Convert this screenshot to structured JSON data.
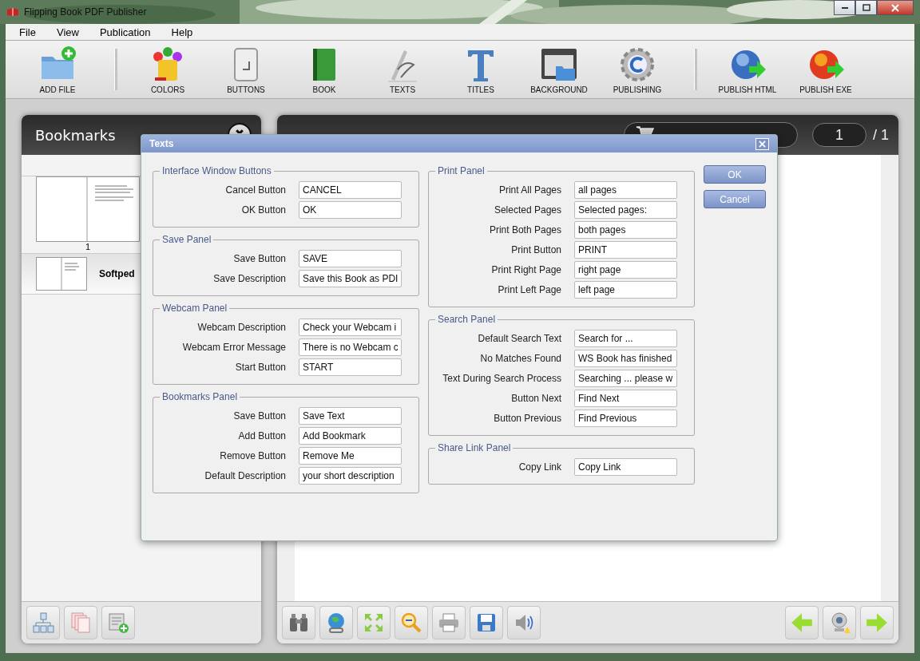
{
  "window": {
    "title": "Flipping Book PDF Publisher"
  },
  "menu": [
    "File",
    "View",
    "Publication",
    "Help"
  ],
  "toolbar_groups": [
    [
      {
        "label": "ADD FILE"
      }
    ],
    [
      {
        "label": "COLORS"
      },
      {
        "label": "BUTTONS"
      },
      {
        "label": "BOOK"
      },
      {
        "label": "TEXTS"
      },
      {
        "label": "TITLES"
      },
      {
        "label": "BACKGROUND"
      },
      {
        "label": "PUBLISHING"
      }
    ],
    [
      {
        "label": "PUBLISH HTML"
      },
      {
        "label": "PUBLISH EXE"
      }
    ]
  ],
  "bookmarks": {
    "title": "Bookmarks",
    "pages": [
      {
        "caption": "1"
      }
    ],
    "items": [
      {
        "label": "Softped",
        "selected": true
      }
    ]
  },
  "document": {
    "page_field": "1",
    "page_total": "/ 1"
  },
  "dialog": {
    "title": "Texts",
    "left_panels": [
      {
        "title": "Interface Window Buttons",
        "fields": [
          {
            "label": "Cancel Button",
            "value": "CANCEL"
          },
          {
            "label": "OK Button",
            "value": "OK"
          }
        ]
      },
      {
        "title": "Save Panel",
        "fields": [
          {
            "label": "Save Button",
            "value": "SAVE"
          },
          {
            "label": "Save Description",
            "value": "Save this Book as PDI"
          }
        ]
      },
      {
        "title": "Webcam Panel",
        "fields": [
          {
            "label": "Webcam Description",
            "value": "Check your Webcam i"
          },
          {
            "label": "Webcam Error Message",
            "value": "There is no Webcam c"
          },
          {
            "label": "Start Button",
            "value": "START"
          }
        ]
      },
      {
        "title": "Bookmarks Panel",
        "fields": [
          {
            "label": "Save Button",
            "value": "Save Text"
          },
          {
            "label": "Add Button",
            "value": "Add Bookmark"
          },
          {
            "label": "Remove Button",
            "value": "Remove Me"
          },
          {
            "label": "Default Description",
            "value": "your short description"
          }
        ]
      }
    ],
    "right_panels": [
      {
        "title": "Print Panel",
        "fields": [
          {
            "label": "Print All Pages",
            "value": "all pages"
          },
          {
            "label": "Selected Pages",
            "value": "Selected pages:"
          },
          {
            "label": "Print Both Pages",
            "value": "both pages"
          },
          {
            "label": "Print Button",
            "value": "PRINT"
          },
          {
            "label": "Print Right Page",
            "value": "right page"
          },
          {
            "label": "Print Left Page",
            "value": "left page"
          }
        ]
      },
      {
        "title": "Search Panel",
        "fields": [
          {
            "label": "Default Search Text",
            "value": "Search for ..."
          },
          {
            "label": "No Matches Found",
            "value": "WS Book has finished"
          },
          {
            "label": "Text During Search Process",
            "value": "Searching ... please w"
          },
          {
            "label": "Button Next",
            "value": "Find Next"
          },
          {
            "label": "Button Previous",
            "value": "Find Previous"
          }
        ]
      },
      {
        "title": "Share Link Panel",
        "fields": [
          {
            "label": "Copy Link",
            "value": "Copy Link"
          }
        ]
      }
    ],
    "buttons": [
      "OK",
      "Cancel"
    ]
  }
}
